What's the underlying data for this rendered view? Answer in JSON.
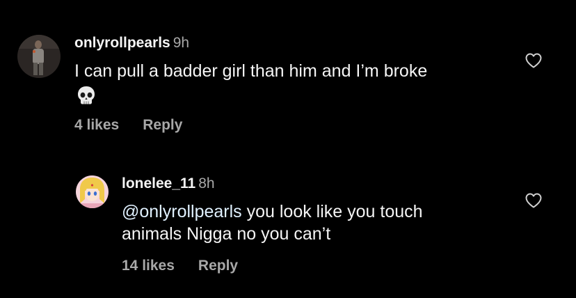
{
  "comments": [
    {
      "username": "onlyrollpearls",
      "time": "9h",
      "text": "I can pull a badder girl than him and I’m broke",
      "emoji": "skull-icon",
      "likes": "4 likes",
      "reply_label": "Reply"
    },
    {
      "username": "lonelee_11",
      "time": "8h",
      "mention": "@onlyrollpearls",
      "text_line1": " you look like you touch",
      "text_line2": "animals Nigga no you can’t",
      "likes": "14 likes",
      "reply_label": "Reply"
    }
  ],
  "colors": {
    "background": "#000000",
    "primary_text": "#f5f5f5",
    "secondary_text": "#a8a8a8"
  }
}
